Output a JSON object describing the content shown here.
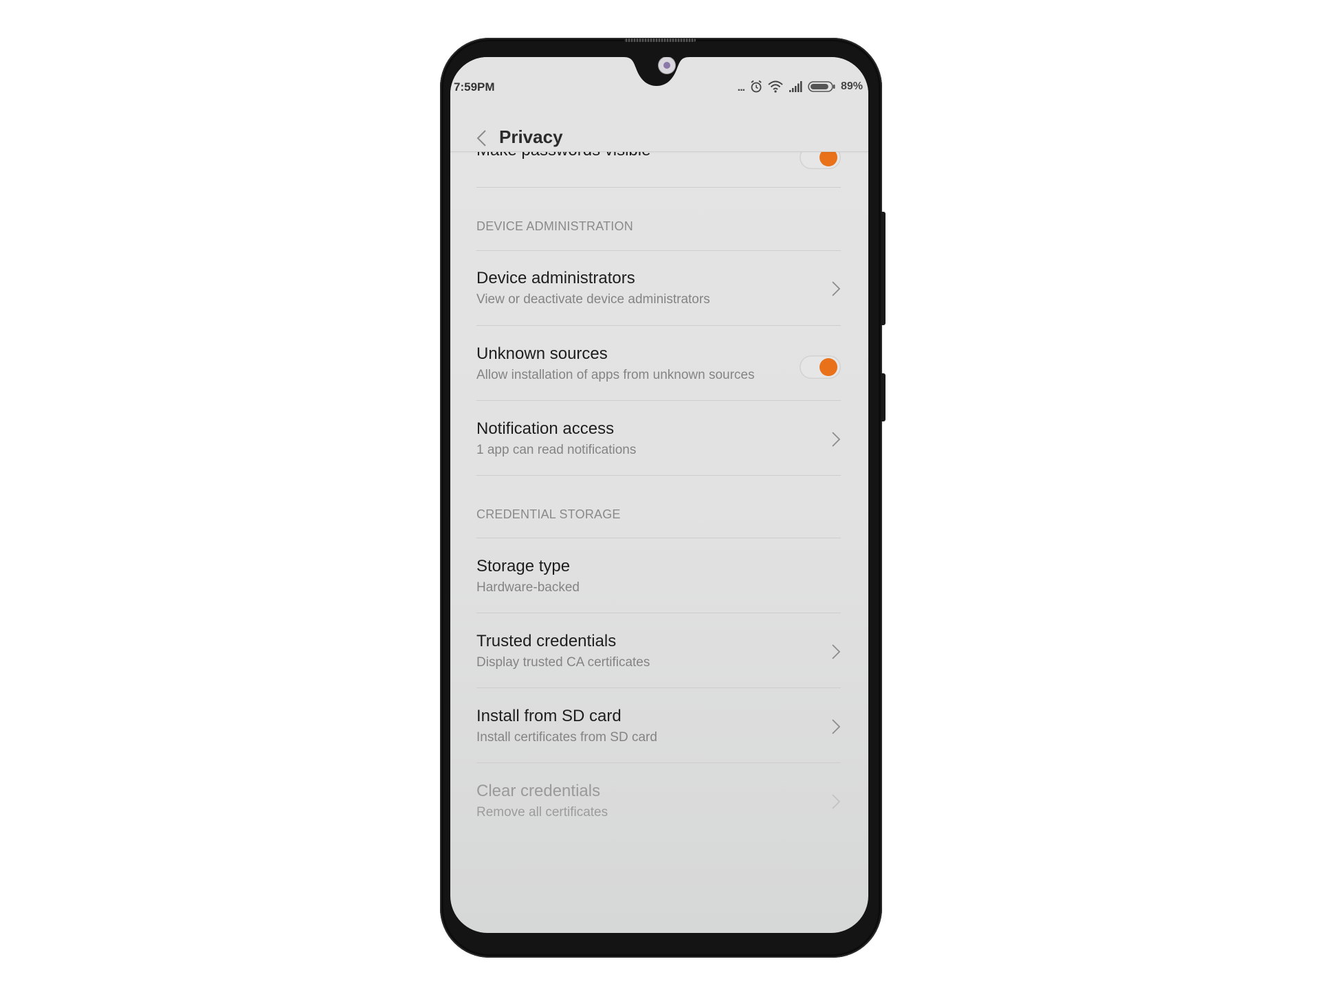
{
  "status_bar": {
    "time": "7:59PM",
    "more_indicator": "...",
    "icons": [
      "alarm-icon",
      "wifi-icon",
      "signal-icon",
      "battery-icon"
    ],
    "battery_percent": "89%",
    "battery_level": 0.89
  },
  "header": {
    "back_icon": "chevron-left-icon",
    "title": "Privacy"
  },
  "accent_color": "#e8711a",
  "items": [
    {
      "type": "toggle",
      "title": "Make passwords visible",
      "subtitle": "",
      "checked": true
    },
    {
      "type": "section",
      "label": "DEVICE ADMINISTRATION"
    },
    {
      "type": "link",
      "title": "Device administrators",
      "subtitle": "View or deactivate device administrators"
    },
    {
      "type": "toggle",
      "title": "Unknown sources",
      "subtitle": "Allow installation of apps from unknown sources",
      "checked": true
    },
    {
      "type": "link",
      "title": "Notification access",
      "subtitle": "1 app can read notifications"
    },
    {
      "type": "section",
      "label": "CREDENTIAL STORAGE"
    },
    {
      "type": "info",
      "title": "Storage type",
      "subtitle": "Hardware-backed"
    },
    {
      "type": "link",
      "title": "Trusted credentials",
      "subtitle": "Display trusted CA certificates"
    },
    {
      "type": "link",
      "title": "Install from SD card",
      "subtitle": "Install certificates from SD card"
    },
    {
      "type": "link",
      "title": "Clear credentials",
      "subtitle": "Remove all certificates",
      "disabled": true
    }
  ]
}
